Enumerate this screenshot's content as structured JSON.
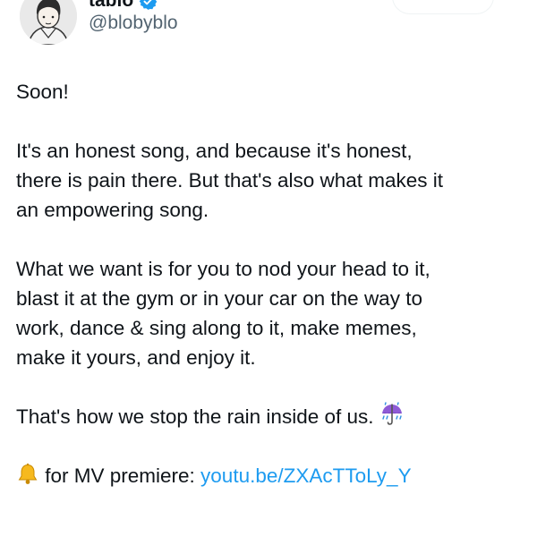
{
  "author": {
    "display_name": "tablo",
    "handle": "@blobyblo",
    "verified": true,
    "avatar": "avatar-boy-illustration"
  },
  "tweet": {
    "line_1": "Soon!",
    "paragraph_2_line_1": "It's an honest song, and because it's honest,",
    "paragraph_2_line_2": "there is pain there. But that's also what makes it",
    "paragraph_2_line_3": "an empowering song.",
    "paragraph_3_line_1": "What we want is for you to nod your head to it,",
    "paragraph_3_line_2": "blast it at the gym or in your car on the way to",
    "paragraph_3_line_3": "work, dance & sing along to it, make memes,",
    "paragraph_3_line_4": "make it yours, and enjoy it.",
    "paragraph_4": "That's how we stop the rain inside of us.",
    "paragraph_4_emoji": "umbrella-with-rain-icon",
    "last_line_emoji": "bell-icon",
    "last_line_text": " for MV premiere: ",
    "link_text": "youtu.be/ZXAcTToLy_Y"
  },
  "colors": {
    "text": "#0f1419",
    "secondary_text": "#536471",
    "link": "#1d9bf0",
    "verified_badge": "#1d9bf0"
  }
}
